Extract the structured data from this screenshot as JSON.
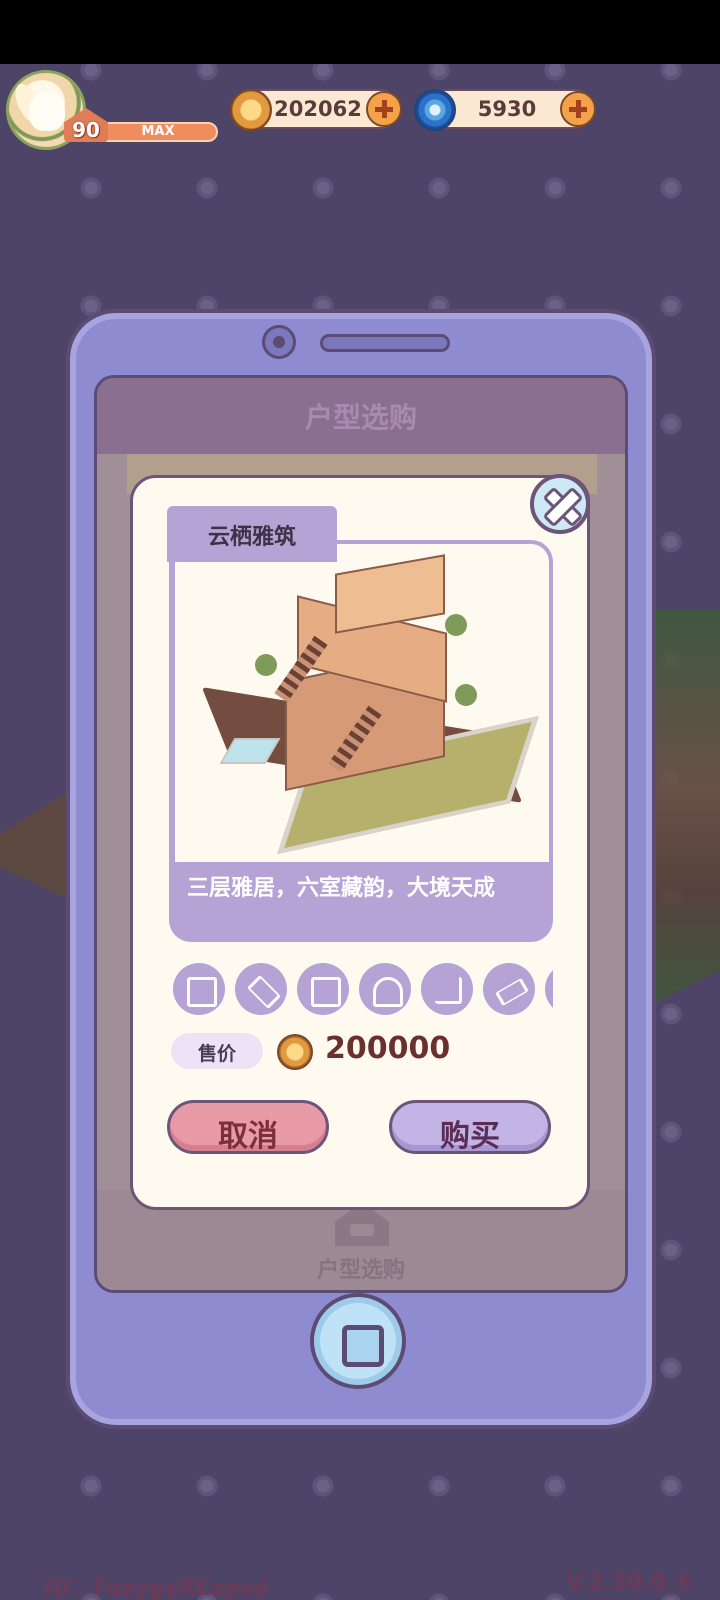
{
  "hud": {
    "level": "90",
    "xp_label": "MAX",
    "coins": "202062",
    "gems": "5930"
  },
  "phone_screen": {
    "title": "户型选购",
    "nav_label": "户型选购"
  },
  "modal": {
    "house_name": "云栖雅筑",
    "description": "三层雅居，六室藏韵，大境天成",
    "features": [
      "piano-icon",
      "rug-icon",
      "bed-icon",
      "fence-icon",
      "stairs-icon",
      "bridge-icon",
      "rug-icon"
    ],
    "price_label": "售价",
    "price_value": "200000",
    "cancel_label": "取消",
    "buy_label": "购买"
  },
  "footer": {
    "id_text": "ID：FazygoREzpsd",
    "version": "V.2.30.0_6"
  },
  "colors": {
    "background": "#4d4468",
    "phone_frame": "#8f8bd0",
    "card": "#b6a3d6",
    "cancel": "#e99aa7",
    "buy": "#c2b4e4",
    "price": "#6a2f2f"
  }
}
